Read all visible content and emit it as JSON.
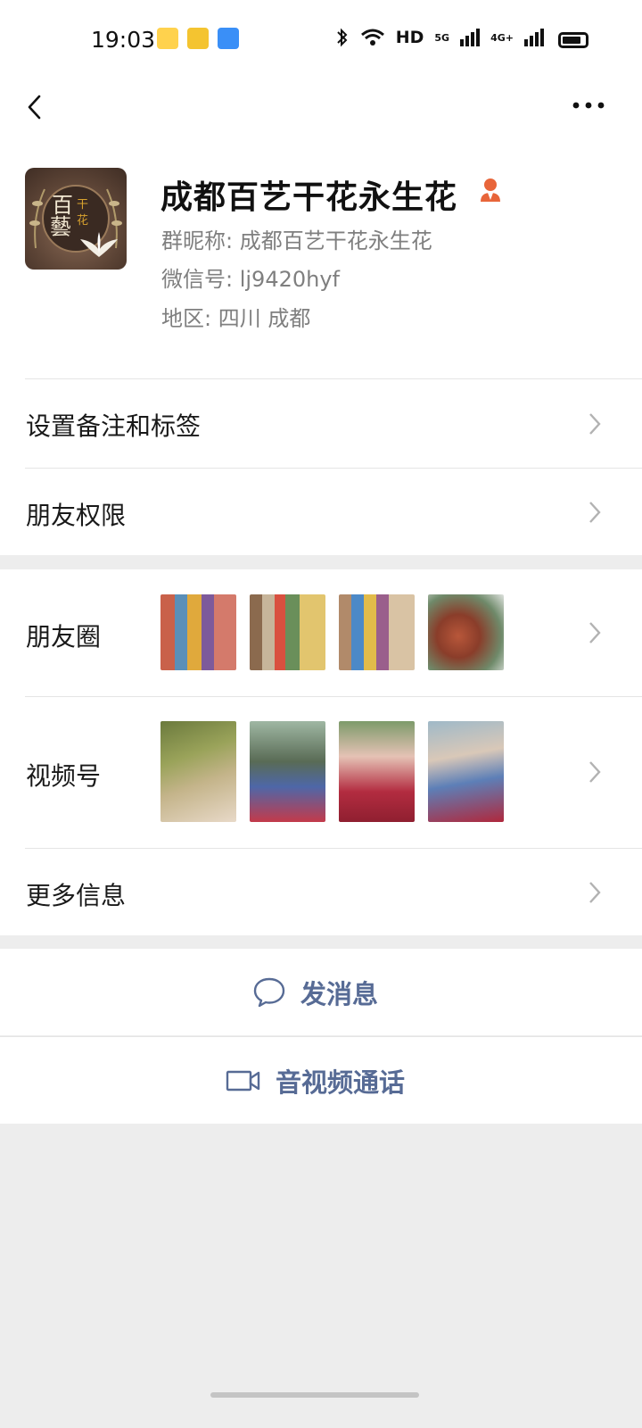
{
  "status_bar": {
    "time": "19:03",
    "network": "HD",
    "signal_1": "5G",
    "signal_2": "4G+",
    "icons": [
      "app-icon",
      "app-icon",
      "app-icon",
      "bluetooth-icon",
      "wifi-icon",
      "signal-icon",
      "battery-icon"
    ]
  },
  "nav": {
    "back_icon": "chevron-left-icon",
    "more_icon": "more-icon"
  },
  "profile": {
    "name": "成都百艺干花永生花",
    "group_nickname": "群昵称: 成都百艺干花永生花",
    "wechat_id": "微信号: lj9420hyf",
    "region": "地区: 四川  成都",
    "avatar_text": [
      "百",
      "藝",
      "干",
      "花"
    ],
    "badge_color": "#e8653a"
  },
  "menu": {
    "note_label": "设置备注和标签",
    "permission_label": "朋友权限",
    "moments_label": "朋友圈",
    "channels_label": "视频号",
    "more_label": "更多信息"
  },
  "actions": {
    "message_label": "发消息",
    "call_label": "音视频通话",
    "accent_color": "#576b95"
  }
}
